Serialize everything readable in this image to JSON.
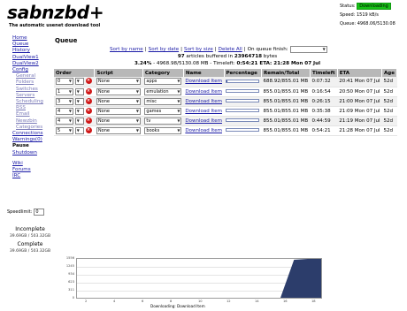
{
  "header": {
    "logo": "sabnzbd+",
    "tagline": "The automatic usenet download tool",
    "status_label": "Status:",
    "status_value": "Downloading",
    "speed_label": "Speed:",
    "speed_value": "1519 kB/s",
    "queue_label": "Queue:",
    "queue_value": "4968.06/5130.08"
  },
  "sidebar": {
    "items": [
      {
        "label": "Home"
      },
      {
        "label": "Queue"
      },
      {
        "label": "History"
      },
      {
        "label": "DualView1"
      },
      {
        "label": "DualView2"
      },
      {
        "label": "Config"
      },
      {
        "label": "General"
      },
      {
        "label": "Folders"
      },
      {
        "label": "Switches"
      },
      {
        "label": "Servers"
      },
      {
        "label": "Scheduling"
      },
      {
        "label": "RSS"
      },
      {
        "label": "Email"
      },
      {
        "label": "Newzbin"
      },
      {
        "label": "Categories"
      },
      {
        "label": "Connections"
      },
      {
        "label": "Warnings(0)"
      },
      {
        "label": "Pause"
      },
      {
        "label": "Shutdown"
      },
      {
        "label": "Wiki"
      },
      {
        "label": "Forums"
      },
      {
        "label": "IRC"
      }
    ],
    "speed_label": "Speedlimit:",
    "speed_value": "0",
    "incomplete_label": "Incomplete",
    "incomplete_value": "39.69GB / 503.32GB",
    "complete_label": "Complete",
    "complete_value": "39.69GB / 503.32GB"
  },
  "queue": {
    "title": "Queue",
    "sort_by_name": "Sort by name",
    "sort_by_date": "Sort by date",
    "sort_by_size": "Sort by size",
    "delete_all": "Delete All",
    "on_finish": "On queue finish:",
    "sep": "|",
    "articles_count": "97",
    "articles_mid": " articles buffered in ",
    "articles_bytes": "23964718",
    "articles_end": " bytes",
    "summary_pct": "3.24%",
    "summary_mid": " - 4968.98/5130.08 MB - Timeleft: ",
    "summary_time": "0:54:21",
    "summary_eta": " ETA: 21:28 Mon 07 Jul",
    "columns": [
      "Order",
      "Script",
      "Category",
      "Name",
      "Percentage",
      "Remain/Total",
      "Timeleft",
      "ETA",
      "Age"
    ],
    "rows": [
      {
        "order": "0",
        "script": "None",
        "category": "apps",
        "name": "Download Item",
        "percent": 0.03,
        "remain": "688.92/855.01 MB",
        "timeleft": "0:07:32",
        "eta": "20:41 Mon 07 Jul",
        "age": "52d"
      },
      {
        "order": "1",
        "script": "None",
        "category": "emulation",
        "name": "Download Item",
        "percent": 0,
        "remain": "855.01/855.01 MB",
        "timeleft": "0:16:54",
        "eta": "20:50 Mon 07 Jul",
        "age": "52d"
      },
      {
        "order": "3",
        "script": "None",
        "category": "misc",
        "name": "Download Item",
        "percent": 0,
        "remain": "855.01/855.01 MB",
        "timeleft": "0:26:15",
        "eta": "21:00 Mon 07 Jul",
        "age": "52d"
      },
      {
        "order": "4",
        "script": "None",
        "category": "games",
        "name": "Download Item",
        "percent": 0,
        "remain": "855.01/855.01 MB",
        "timeleft": "0:35:38",
        "eta": "21:09 Mon 07 Jul",
        "age": "52d"
      },
      {
        "order": "4",
        "script": "None",
        "category": "tv",
        "name": "Download Item",
        "percent": 0,
        "remain": "855.01/855.01 MB",
        "timeleft": "0:44:59",
        "eta": "21:19 Mon 07 Jul",
        "age": "52d"
      },
      {
        "order": "5",
        "script": "None",
        "category": "books",
        "name": "Download Item",
        "percent": 0,
        "remain": "855.01/855.01 MB",
        "timeleft": "0:54:21",
        "eta": "21:28 Mon 07 Jul",
        "age": "52d"
      }
    ]
  },
  "graph": {
    "yticks": [
      "1556",
      "1245",
      "934",
      "623",
      "311",
      "0"
    ],
    "xticks": [
      "2",
      "4",
      "6",
      "8",
      "10",
      "12",
      "14",
      "16",
      "18"
    ],
    "caption": "Downloading: Download Item",
    "values": [
      0,
      0,
      0,
      0,
      0,
      0,
      0,
      0,
      0,
      0,
      0,
      0,
      0,
      0,
      0,
      0,
      1519,
      1556,
      1556
    ],
    "ymax": 1556,
    "fill_color": "#2c3d6b"
  },
  "colors": {
    "status_badge": "#16c216",
    "link": "#1a1aa6",
    "delete_button": "#d01818",
    "header_bg": "#b8b8b8"
  }
}
